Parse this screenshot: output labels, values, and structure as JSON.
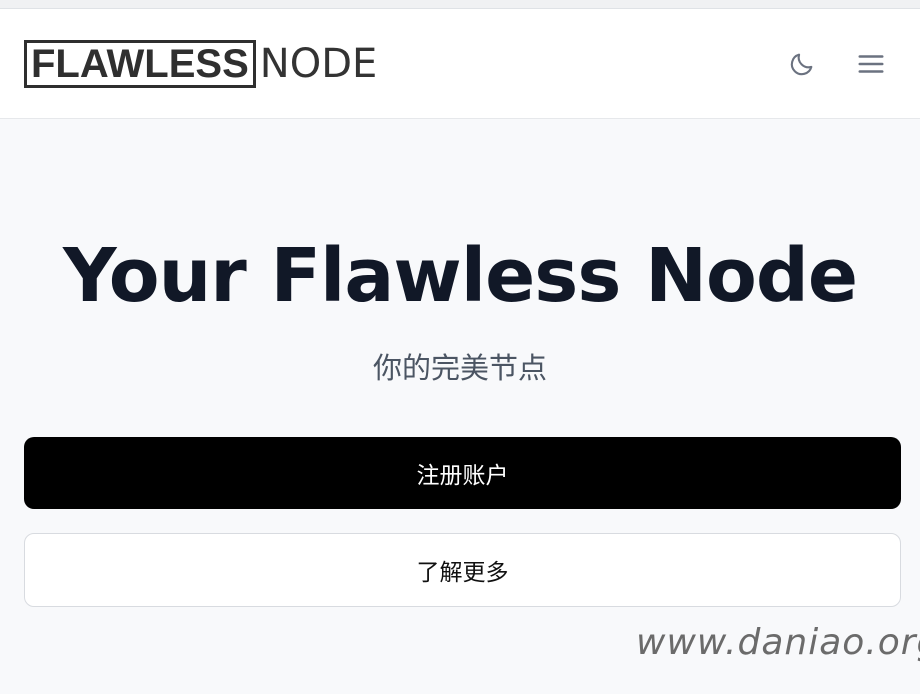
{
  "header": {
    "logo_bold": "FLAWLESS",
    "logo_light": "NODE",
    "theme_toggle_icon": "moon-icon",
    "menu_icon": "hamburger-menu-icon"
  },
  "hero": {
    "title": "Your Flawless Node",
    "subtitle": "你的完美节点"
  },
  "actions": {
    "primary_label": "注册账户",
    "secondary_label": "了解更多"
  },
  "watermark": "www.daniao.org",
  "colors": {
    "page_bg": "#f8f9fb",
    "header_bg": "#ffffff",
    "title": "#111827",
    "primary_button": "#000000"
  }
}
